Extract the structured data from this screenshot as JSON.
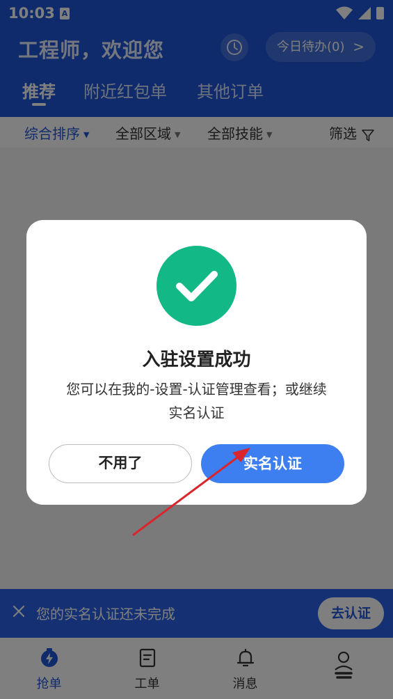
{
  "status_bar": {
    "time": "10:03",
    "notification_letter": "A"
  },
  "header": {
    "greeting": "工程师，欢迎您",
    "todo_button": "今日待办(0)",
    "todo_chevron": ">",
    "tabs": [
      {
        "label": "推荐",
        "active": true
      },
      {
        "label": "附近红包单",
        "active": false
      },
      {
        "label": "其他订单",
        "active": false
      }
    ]
  },
  "filters": [
    {
      "label": "综合排序",
      "active": true
    },
    {
      "label": "全部区域",
      "active": false
    },
    {
      "label": "全部技能",
      "active": false
    }
  ],
  "filter_button": "筛选",
  "dialog": {
    "title": "入驻设置成功",
    "message_line1": "您可以在我的-设置-认证管理查看；或继续",
    "message_line2": "实名认证",
    "cancel_label": "不用了",
    "confirm_label": "实名认证"
  },
  "banner": {
    "text": "您的实名认证还未完成",
    "button_label": "去认证"
  },
  "bottom_nav": [
    {
      "label": "抢单",
      "icon": "lightning-icon",
      "active": true
    },
    {
      "label": "工单",
      "icon": "document-icon",
      "active": false
    },
    {
      "label": "消息",
      "icon": "bell-icon",
      "active": false
    },
    {
      "label": "",
      "icon": "profile-icon",
      "active": false
    }
  ],
  "colors": {
    "primary": "#1f56d6",
    "success": "#12b886",
    "confirm_button": "#3d7ff0",
    "annotation_arrow": "#d9252b"
  }
}
